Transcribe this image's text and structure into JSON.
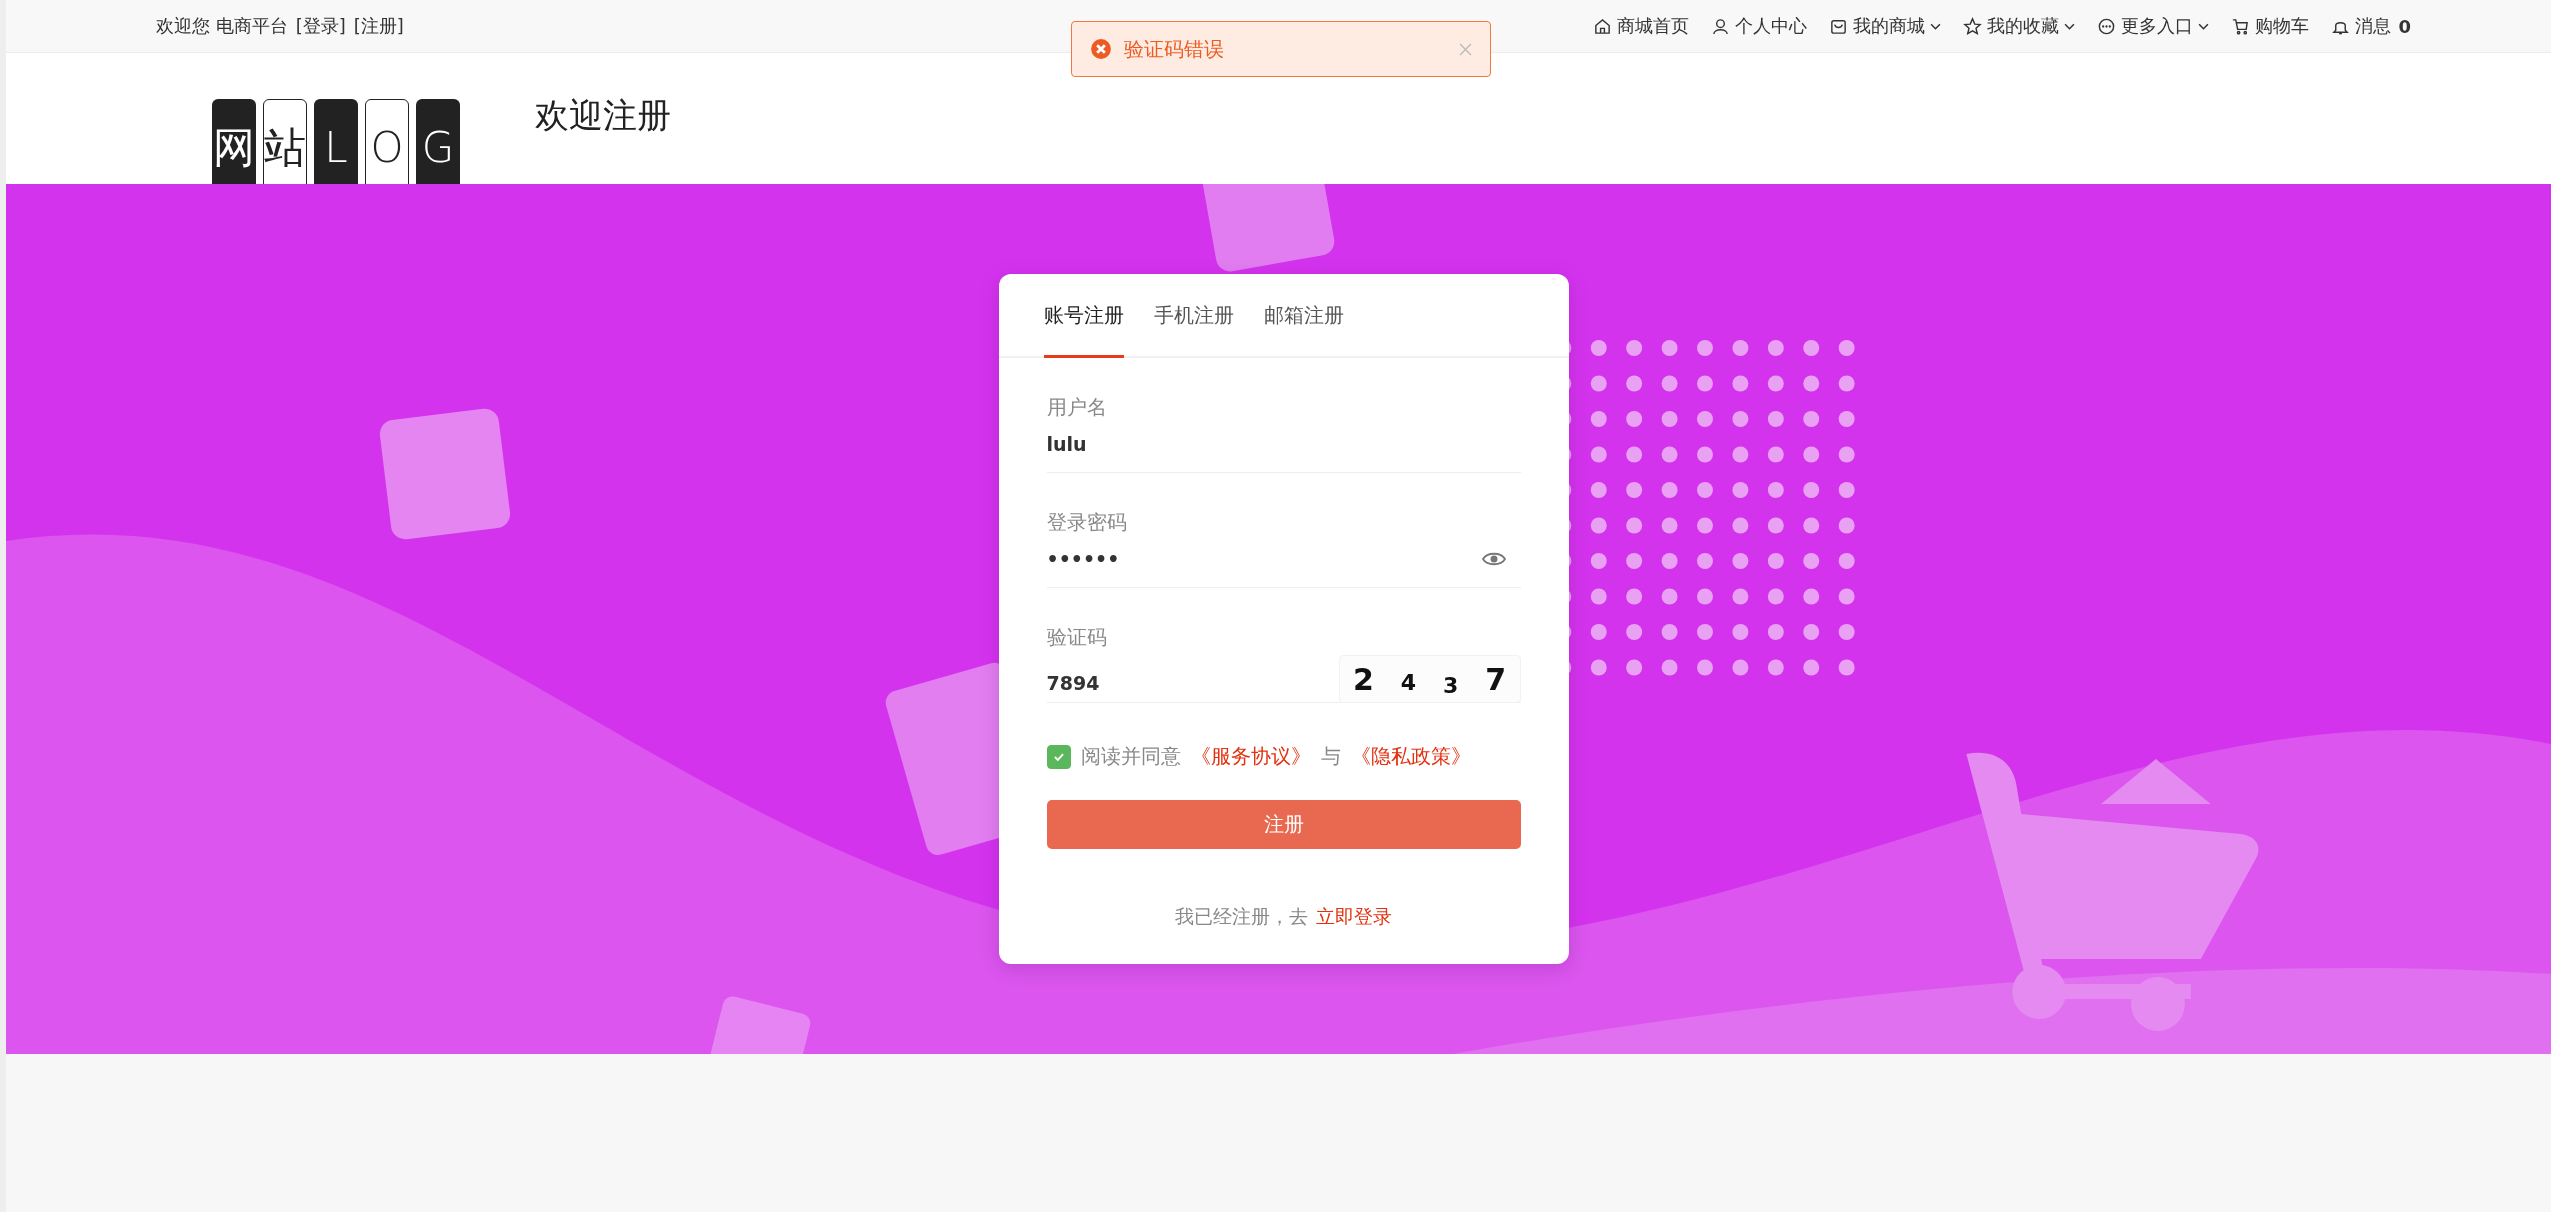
{
  "top_bar": {
    "welcome": "欢迎您 电商平台",
    "links": [
      "[登录]",
      "[注册]"
    ],
    "nav": [
      {
        "kind": "home",
        "label": "商城首页",
        "caret": false
      },
      {
        "kind": "user",
        "label": "个人中心",
        "caret": false
      },
      {
        "kind": "shop",
        "label": "我的商城",
        "caret": true
      },
      {
        "kind": "star",
        "label": "我的收藏",
        "caret": true
      },
      {
        "kind": "more",
        "label": "更多入口",
        "caret": true
      },
      {
        "kind": "cart",
        "label": "购物车",
        "caret": false
      },
      {
        "kind": "bell",
        "label": "消息",
        "caret": false,
        "badge": "0"
      }
    ]
  },
  "toast": {
    "kind": "error",
    "text": "验证码错误"
  },
  "header": {
    "logo": [
      "网",
      "站",
      "L",
      "O",
      "G"
    ],
    "title": "欢迎注册"
  },
  "tabs": [
    {
      "label": "账号注册",
      "selected": true
    },
    {
      "label": "手机注册",
      "selected": false
    },
    {
      "label": "邮箱注册",
      "selected": false
    }
  ],
  "fields": [
    {
      "kind": "text",
      "label": "用户名",
      "value": "lulu"
    },
    {
      "kind": "password",
      "label": "登录密码",
      "value": "••••••"
    },
    {
      "kind": "captcha",
      "label": "验证码",
      "value": "7894",
      "captcha": [
        "2",
        "4",
        "3",
        "7"
      ]
    }
  ],
  "agreement": {
    "checked": true,
    "text": "阅读并同意",
    "links": [
      "《服务协议》",
      "《隐私政策》"
    ],
    "joiner": "与"
  },
  "submit": "注册",
  "footer": {
    "text": "我已经注册，去",
    "link": "立即登录"
  }
}
